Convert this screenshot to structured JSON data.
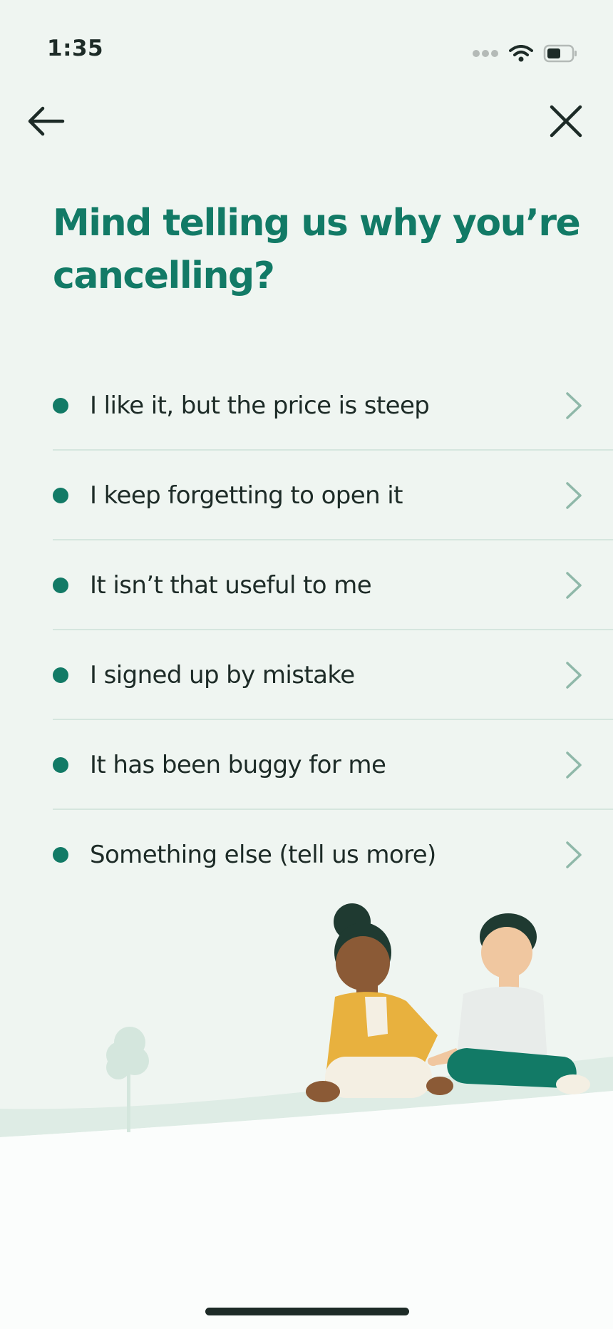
{
  "status_bar": {
    "time": "1:35",
    "icons": [
      "signal-dots-icon",
      "wifi-icon",
      "battery-icon"
    ]
  },
  "nav": {
    "back_icon": "arrow-left-icon",
    "close_icon": "close-icon"
  },
  "title": "Mind telling us why you’re cancelling?",
  "options": [
    {
      "label": "I like it, but the price is steep"
    },
    {
      "label": "I keep forgetting to open it"
    },
    {
      "label": "It isn’t that useful to me"
    },
    {
      "label": "I signed up by mistake"
    },
    {
      "label": "It has been buggy for me"
    },
    {
      "label": "Something else (tell us more)"
    }
  ],
  "colors": {
    "accent": "#127a66",
    "background": "#eff5f1",
    "divider": "#d5e6de",
    "chevron": "#8fb8a9",
    "text": "#1d2b27"
  }
}
